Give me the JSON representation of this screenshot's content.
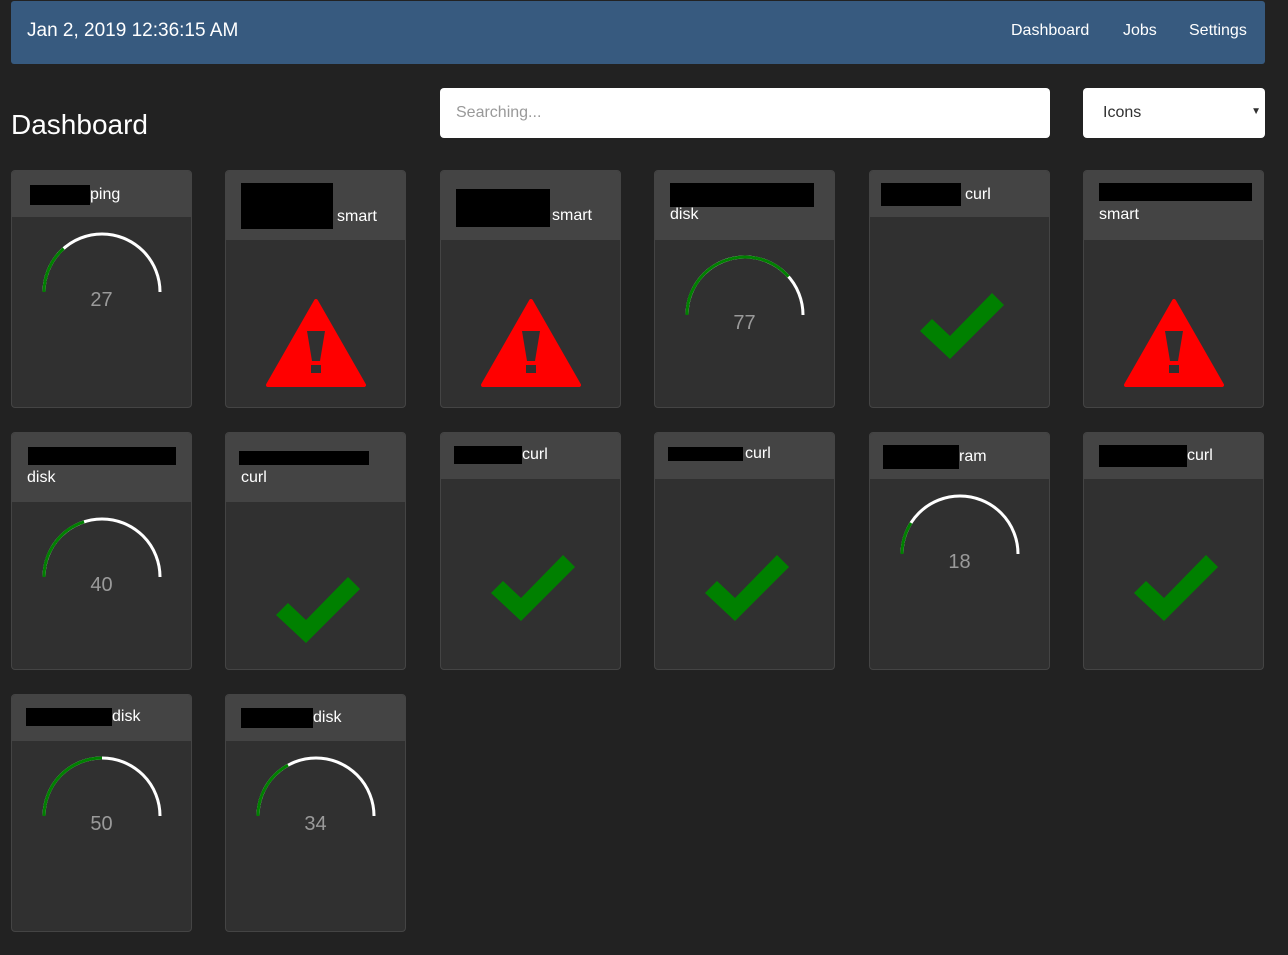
{
  "navbar": {
    "datetime": "Jan 2, 2019 12:36:15 AM",
    "links": [
      "Dashboard",
      "Jobs",
      "Settings"
    ]
  },
  "page": {
    "title": "Dashboard"
  },
  "search": {
    "placeholder": "Searching..."
  },
  "view_select": {
    "value": "Icons"
  },
  "colors": {
    "background": "#222222",
    "navbar": "#375a7f",
    "card": "#303030",
    "card_header": "#444444",
    "ok": "#008000",
    "error": "#ff0000",
    "gauge_track": "#ffffff",
    "gauge_value_text": "#9a9a9a"
  },
  "cards": [
    {
      "suffix": "ping",
      "status": "gauge",
      "value": 27
    },
    {
      "suffix": "smart",
      "status": "error-icon"
    },
    {
      "suffix": "smart",
      "status": "error-icon"
    },
    {
      "suffix": "disk",
      "status": "gauge",
      "value": 77
    },
    {
      "suffix": "curl",
      "status": "ok-icon"
    },
    {
      "suffix": "smart",
      "status": "error-icon"
    },
    {
      "suffix": "disk",
      "status": "gauge",
      "value": 40
    },
    {
      "suffix": "curl",
      "status": "ok-icon"
    },
    {
      "suffix": "curl",
      "status": "ok-icon"
    },
    {
      "suffix": "curl",
      "status": "ok-icon"
    },
    {
      "suffix": "ram",
      "status": "gauge",
      "value": 18
    },
    {
      "suffix": "curl",
      "status": "ok-icon"
    },
    {
      "suffix": "disk",
      "status": "gauge",
      "value": 50
    },
    {
      "suffix": "disk",
      "status": "gauge",
      "value": 34
    }
  ]
}
